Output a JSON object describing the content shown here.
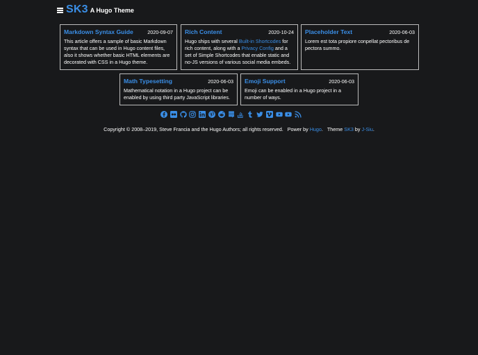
{
  "header": {
    "title": "SK3",
    "subtitle": "A Hugo Theme",
    "menu_icon": "hamburger-menu-icon"
  },
  "cards": [
    {
      "title": "Markdown Syntax Guide",
      "date": "2020-09-07",
      "summary": "This article offers a sample of basic Markdown syntax that can be used in Hugo content files, also it shows whether basic HTML elements are decorated with CSS in a Hugo theme."
    },
    {
      "title": "Rich Content",
      "date": "2020-10-24",
      "summary_parts": [
        "Hugo ships with several ",
        "Built-in Shortcodes",
        " for rich content, along with a ",
        "Privacy Config",
        " and a set of Simple Shortcodes that enable static and no-JS versions of various social media embeds."
      ]
    },
    {
      "title": "Placeholder Text",
      "date": "2020-06-03",
      "summary": "Lorem est tota propiore conpellat pectoribus de pectora summo."
    },
    {
      "title": "Math Typesetting",
      "date": "2020-06-03",
      "summary": "Mathematical notation in a Hugo project can be enabled by using third party JavaScript libraries."
    },
    {
      "title": "Emoji Support",
      "date": "2020-06-03",
      "summary": "Emoji can be enabled in a Hugo project in a number of ways."
    }
  ],
  "social_icons": [
    "facebook-icon",
    "flickr-icon",
    "github-icon",
    "instagram-icon",
    "linkedin-icon",
    "pinterest-icon",
    "reddit-icon",
    "stack-exchange-icon",
    "stack-overflow-icon",
    "tumblr-icon",
    "twitter-icon",
    "vimeo-icon",
    "youtube-icon",
    "youtube-alt-icon",
    "rss-icon"
  ],
  "footer": {
    "copyright": "Copyright © 2008–2019, Steve Francia and the Hugo Authors; all rights reserved.",
    "power_by": "Power by",
    "hugo_link": "Hugo",
    "theme_label": "Theme",
    "theme_link": "SK3",
    "by_label": "by",
    "author_link": "J-Siu"
  },
  "colors": {
    "background": "#18191b",
    "accent": "#3a8ee6",
    "text": "#ffffff",
    "border": "#bdbdbd"
  }
}
